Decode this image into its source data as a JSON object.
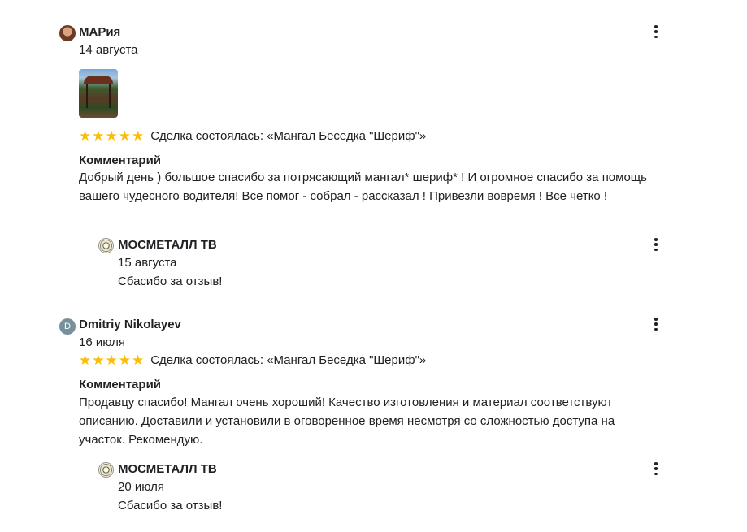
{
  "reviews": [
    {
      "author": "МАРия",
      "date": "14 августа",
      "avatar_icon": "user-photo-avatar",
      "rating_stars": "★★★★★",
      "rating_value": 5,
      "deal": "Сделка состоялась: «Мангал Беседка \"Шериф\"»",
      "comment_title": "Комментарий",
      "comment": "Добрый день ) большое спасибо за потрясающий мангал* шериф* ! И огромное спасибо за помощь вашего чудесного водителя! Все помог - собрал - рассказал ! Привезли вовремя ! Все четко !",
      "reply": {
        "author": "МОСМЕТАЛЛ ТВ",
        "date": "15 августа",
        "text": "Сбасибо за отзыв!"
      }
    },
    {
      "author": "Dmitriy Nikolayev",
      "date": "16 июля",
      "avatar_letter": "D",
      "rating_stars": "★★★★★",
      "rating_value": 5,
      "deal": "Сделка состоялась: «Мангал Беседка \"Шериф\"»",
      "comment_title": "Комментарий",
      "comment": "Продавцу спасибо! Мангал очень хороший! Качество изготовления и материал соответствуют описанию. Доставили и установили в оговоренное время несмотря со сложностью доступа на участок. Рекомендую.",
      "reply": {
        "author": "МОСМЕТАЛЛ ТВ",
        "date": "20 июля",
        "text": "Сбасибо за отзыв!"
      }
    }
  ],
  "colors": {
    "star": "#fbbc04",
    "text": "#202124",
    "letter_avatar": "#78909c"
  }
}
